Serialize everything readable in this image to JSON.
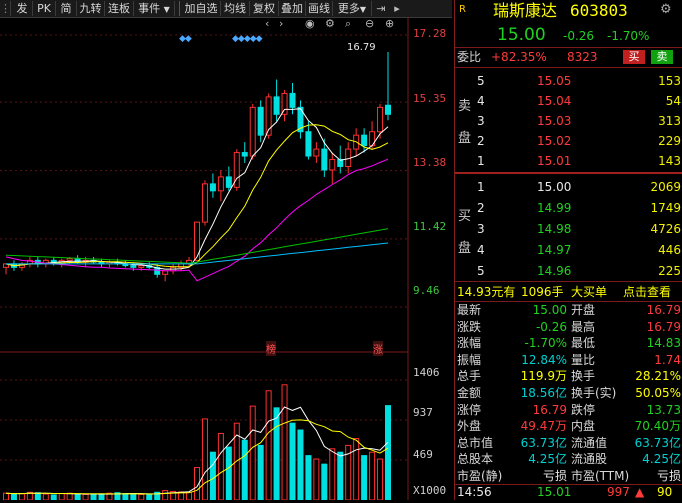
{
  "toolbar": {
    "buttons": [
      "发",
      "PK",
      "简",
      "九转",
      "连板",
      "事件",
      "加自选",
      "均线",
      "复权",
      "叠加",
      "画线",
      "更多"
    ],
    "icons": [
      "back-icon",
      "forward-icon",
      "eye-icon",
      "settings-icon",
      "search-icon",
      "minus-icon",
      "plus-icon",
      "exit-icon",
      "next-icon"
    ]
  },
  "chart": {
    "price_axis": [
      "17.28",
      "15.35",
      "13.38",
      "11.42",
      "9.46"
    ],
    "vol_axis": [
      "1406",
      "937",
      "469"
    ],
    "vol_unit": "X1000",
    "high_label": "16.79",
    "markers": [
      "榜",
      "涨"
    ],
    "colors": {
      "up": "#ff3030",
      "down": "#00e0e0",
      "ma5": "#ffffff",
      "ma10": "#ffff00",
      "ma20": "#ff00ff",
      "ma60": "#00c000",
      "ma120": "#00bfff"
    }
  },
  "chart_data": {
    "type": "candlestick",
    "ylim": [
      9.46,
      17.28
    ],
    "candles": [
      [
        10.6,
        10.7,
        10.4,
        10.7
      ],
      [
        10.7,
        10.8,
        10.5,
        10.6
      ],
      [
        10.6,
        10.75,
        10.5,
        10.7
      ],
      [
        10.7,
        10.9,
        10.6,
        10.8
      ],
      [
        10.8,
        10.9,
        10.6,
        10.7
      ],
      [
        10.7,
        10.85,
        10.6,
        10.8
      ],
      [
        10.8,
        10.9,
        10.65,
        10.7
      ],
      [
        10.7,
        10.85,
        10.6,
        10.8
      ],
      [
        10.8,
        10.9,
        10.7,
        10.85
      ],
      [
        10.85,
        10.95,
        10.7,
        10.75
      ],
      [
        10.75,
        10.9,
        10.6,
        10.8
      ],
      [
        10.8,
        10.9,
        10.7,
        10.75
      ],
      [
        10.75,
        10.85,
        10.6,
        10.7
      ],
      [
        10.7,
        10.8,
        10.6,
        10.75
      ],
      [
        10.75,
        10.85,
        10.65,
        10.7
      ],
      [
        10.7,
        10.8,
        10.6,
        10.65
      ],
      [
        10.65,
        10.75,
        10.5,
        10.6
      ],
      [
        10.6,
        10.7,
        10.5,
        10.65
      ],
      [
        10.65,
        10.75,
        10.55,
        10.6
      ],
      [
        10.6,
        10.7,
        10.3,
        10.4
      ],
      [
        10.4,
        10.5,
        10.2,
        10.5
      ],
      [
        10.5,
        10.7,
        10.4,
        10.6
      ],
      [
        10.6,
        10.8,
        10.5,
        10.7
      ],
      [
        10.7,
        10.9,
        10.6,
        10.8
      ],
      [
        10.8,
        11.9,
        10.8,
        11.9
      ],
      [
        11.9,
        13.1,
        11.8,
        13.0
      ],
      [
        13.0,
        13.3,
        12.6,
        12.8
      ],
      [
        12.8,
        13.4,
        12.5,
        13.2
      ],
      [
        13.2,
        13.5,
        12.8,
        12.9
      ],
      [
        12.9,
        14.0,
        12.8,
        13.9
      ],
      [
        13.9,
        14.2,
        13.6,
        13.8
      ],
      [
        13.8,
        15.3,
        13.7,
        15.2
      ],
      [
        15.2,
        15.4,
        14.2,
        14.4
      ],
      [
        14.4,
        15.6,
        14.3,
        15.5
      ],
      [
        15.5,
        16.0,
        14.8,
        15.0
      ],
      [
        15.0,
        15.7,
        14.8,
        15.6
      ],
      [
        15.6,
        15.9,
        15.0,
        15.2
      ],
      [
        15.2,
        15.4,
        14.3,
        14.5
      ],
      [
        14.5,
        14.8,
        13.7,
        13.8
      ],
      [
        13.8,
        14.2,
        13.6,
        14.0
      ],
      [
        14.0,
        14.3,
        13.2,
        13.4
      ],
      [
        13.4,
        13.9,
        13.0,
        13.7
      ],
      [
        13.7,
        14.1,
        13.3,
        13.5
      ],
      [
        13.5,
        14.2,
        13.3,
        14.0
      ],
      [
        14.0,
        14.6,
        13.8,
        14.4
      ],
      [
        14.4,
        14.6,
        13.9,
        14.1
      ],
      [
        14.1,
        14.8,
        14.0,
        14.5
      ],
      [
        14.5,
        15.3,
        14.3,
        15.2
      ],
      [
        15.26,
        16.79,
        14.83,
        15.0
      ]
    ],
    "volume": [
      80,
      70,
      75,
      90,
      85,
      70,
      60,
      75,
      80,
      70,
      65,
      60,
      70,
      80,
      85,
      75,
      70,
      65,
      60,
      90,
      110,
      100,
      95,
      90,
      380,
      950,
      560,
      780,
      620,
      900,
      700,
      1100,
      640,
      1280,
      1080,
      1350,
      900,
      820,
      520,
      480,
      420,
      600,
      560,
      640,
      720,
      520,
      560,
      480,
      1106
    ]
  },
  "panel": {
    "r_badge": "R",
    "stock_name": "瑞斯康达",
    "stock_code": "603803",
    "price": "15.00",
    "change": "-0.26",
    "change_pct": "-1.70%",
    "weibi_label": "委比",
    "weibi": "+82.35%",
    "weicha": "8323",
    "sell_btn": "买",
    "buy_btn": "卖",
    "sell_side_label": [
      "卖",
      "盘"
    ],
    "buy_side_label": [
      "买",
      "盘"
    ],
    "asks": [
      {
        "idx": "5",
        "price": "15.05",
        "vol": "153"
      },
      {
        "idx": "4",
        "price": "15.04",
        "vol": "54"
      },
      {
        "idx": "3",
        "price": "15.03",
        "vol": "313"
      },
      {
        "idx": "2",
        "price": "15.02",
        "vol": "229"
      },
      {
        "idx": "1",
        "price": "15.01",
        "vol": "143"
      }
    ],
    "bids": [
      {
        "idx": "1",
        "price": "15.00",
        "vol": "2069"
      },
      {
        "idx": "2",
        "price": "14.99",
        "vol": "1749"
      },
      {
        "idx": "3",
        "price": "14.98",
        "vol": "4726"
      },
      {
        "idx": "4",
        "price": "14.97",
        "vol": "446"
      },
      {
        "idx": "5",
        "price": "14.96",
        "vol": "225"
      }
    ],
    "bigorder": {
      "price": "14.93元有",
      "vol": "1096手",
      "type": "大买单",
      "link": "点击查看"
    },
    "fields": [
      {
        "l": "最新",
        "v": "15.00",
        "c": "green",
        "l2": "开盘",
        "v2": "16.79",
        "c2": "red"
      },
      {
        "l": "涨跌",
        "v": "-0.26",
        "c": "green",
        "l2": "最高",
        "v2": "16.79",
        "c2": "red"
      },
      {
        "l": "涨幅",
        "v": "-1.70%",
        "c": "green",
        "l2": "最低",
        "v2": "14.83",
        "c2": "green"
      },
      {
        "l": "振幅",
        "v": "12.84%",
        "c": "cyan",
        "l2": "量比",
        "v2": "1.74",
        "c2": "red"
      },
      {
        "l": "总手",
        "v": "119.9万",
        "c": "yellow",
        "l2": "换手",
        "v2": "28.21%",
        "c2": "yellow"
      },
      {
        "l": "金额",
        "v": "18.56亿",
        "c": "cyan",
        "l2": "换手(实)",
        "v2": "50.05%",
        "c2": "yellow"
      },
      {
        "l": "涨停",
        "v": "16.79",
        "c": "red",
        "l2": "跌停",
        "v2": "13.73",
        "c2": "green"
      },
      {
        "l": "外盘",
        "v": "49.47万",
        "c": "red",
        "l2": "内盘",
        "v2": "70.40万",
        "c2": "green"
      },
      {
        "l": "总市值",
        "v": "63.73亿",
        "c": "cyan",
        "l2": "流通值",
        "v2": "63.73亿",
        "c2": "cyan"
      },
      {
        "l": "总股本",
        "v": "4.25亿",
        "c": "cyan",
        "l2": "流通股",
        "v2": "4.25亿",
        "c2": "cyan"
      },
      {
        "l": "市盈(静)",
        "v": "亏损",
        "c": "white",
        "l2": "市盈(TTM)",
        "v2": "亏损",
        "c2": "white"
      }
    ],
    "tick": {
      "time": "14:56",
      "price": "15.01",
      "vol": "997",
      "dir": "up-arrow-icon",
      "extra": "90"
    }
  }
}
